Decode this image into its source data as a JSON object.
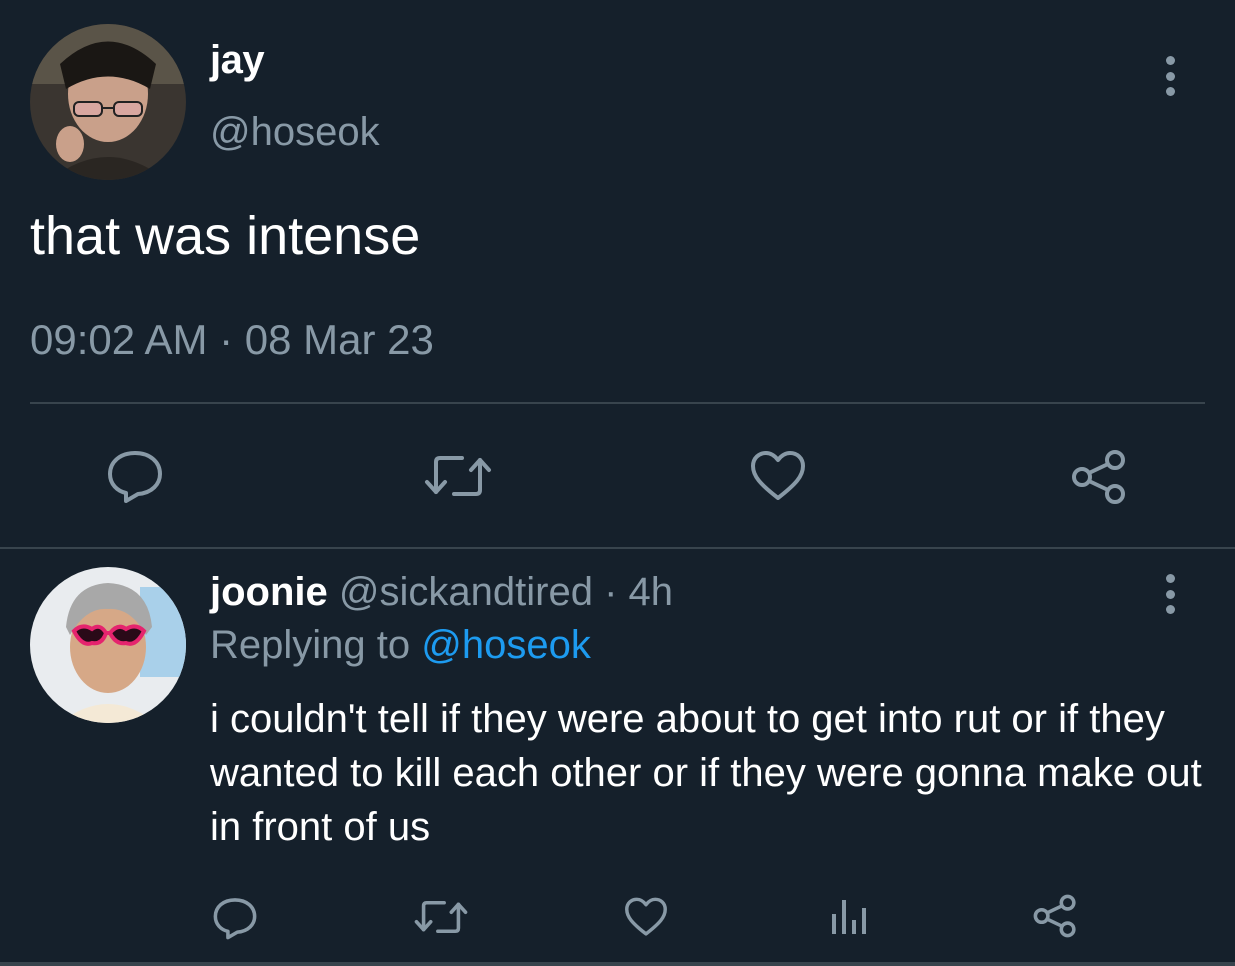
{
  "colors": {
    "background": "#15202b",
    "divider": "#38444d",
    "secondary_text": "#8899a6",
    "mention": "#1d9bf0"
  },
  "main_tweet": {
    "display_name": "jay",
    "handle": "@hoseok",
    "text": "that was intense",
    "timestamp": "09:02 AM · 08 Mar 23",
    "actions": [
      "reply-icon",
      "retweet-icon",
      "like-icon",
      "share-icon"
    ]
  },
  "reply_tweet": {
    "display_name": "joonie",
    "handle": "@sickandtired",
    "separator": " · ",
    "age": "4h",
    "replying_label": "Replying to ",
    "replying_handle": "@hoseok",
    "text": "i couldn't tell if they were about to get into rut or if they wanted to kill each other or if they were gonna make out in front of us",
    "actions": [
      "reply-icon",
      "retweet-icon",
      "like-icon",
      "analytics-icon",
      "share-icon"
    ]
  }
}
